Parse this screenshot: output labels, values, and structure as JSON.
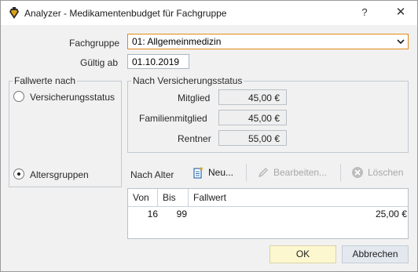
{
  "window": {
    "title": "Analyzer - Medikamentenbudget für Fachgruppe",
    "help_glyph": "?",
    "close_glyph": "✕"
  },
  "form": {
    "fachgruppe_label": "Fachgruppe",
    "fachgruppe_value": "01: Allgemeinmedizin",
    "gueltig_label": "Gültig ab",
    "gueltig_value": "01.10.2019"
  },
  "fallwerte": {
    "caption": "Fallwerte nach",
    "option_versicherung": "Versicherungsstatus",
    "option_alter": "Altersgruppen",
    "selected": "Altersgruppen"
  },
  "versicherungsstatus": {
    "caption": "Nach Versicherungsstatus",
    "rows": [
      {
        "label": "Mitglied",
        "value": "45,00 €"
      },
      {
        "label": "Familienmitglied",
        "value": "45,00 €"
      },
      {
        "label": "Rentner",
        "value": "55,00 €"
      }
    ]
  },
  "alter": {
    "label": "Nach Alter",
    "new_label": "Neu...",
    "edit_label": "Bearbeiten...",
    "delete_label": "Löschen",
    "columns": [
      "Von",
      "Bis",
      "Fallwert"
    ],
    "rows": [
      {
        "von": "16",
        "bis": "99",
        "fallwert": "25,00 €"
      }
    ]
  },
  "buttons": {
    "ok": "OK",
    "cancel": "Abbrechen"
  },
  "colors": {
    "focus_border": "#e08a16",
    "ok_bg": "#fdf7cf",
    "cancel_bg": "#e3e8ef",
    "new_icon": "#2a6fb0",
    "disabled_text": "#a8a8a8"
  }
}
